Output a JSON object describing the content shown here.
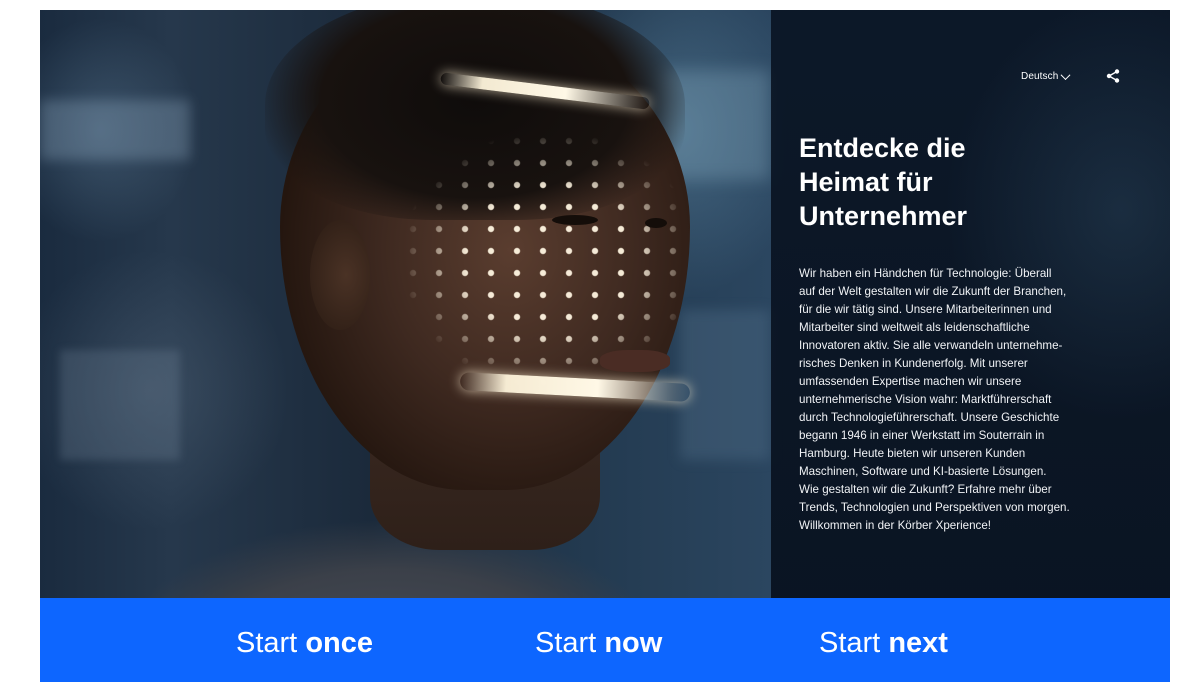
{
  "header": {
    "language_label": "Deutsch"
  },
  "hero": {
    "title_lines": [
      "Entdecke die",
      "Heimat für",
      "Unternehmer"
    ],
    "body_lines": [
      "Wir haben ein Händchen für Technologie: Überall",
      "auf der Welt gestalten wir die Zukunft der Branchen,",
      "für die wir tätig sind. Unsere Mitarbeiterinnen und",
      "Mitarbeiter sind weltweit als leidenschaftliche",
      "Innovatoren aktiv. Sie alle verwandeln unternehme-",
      "risches Denken in Kundenerfolg. Mit unserer",
      "umfassenden Expertise machen wir unsere",
      "unternehmerische Vision wahr: Marktführerschaft",
      "durch Technologieführerschaft. Unsere Geschichte",
      "begann 1946 in einer Werkstatt im Souterrain in",
      "Hamburg. Heute bieten wir unseren Kunden",
      "Maschinen, Software und KI-basierte Lösungen.",
      "Wie gestalten wir die Zukunft? Erfahre mehr über",
      "Trends, Technologien und Perspektiven von morgen.",
      "Willkommen in der Körber Xperience!"
    ]
  },
  "bottom_bar": {
    "items": [
      {
        "prefix": "Start",
        "bold": "once"
      },
      {
        "prefix": "Start",
        "bold": "now"
      },
      {
        "prefix": "Start",
        "bold": "next"
      }
    ],
    "background_color": "#0d66ff"
  },
  "icons": {
    "language_dropdown": "chevron-down-icon",
    "share": "share-icon"
  }
}
